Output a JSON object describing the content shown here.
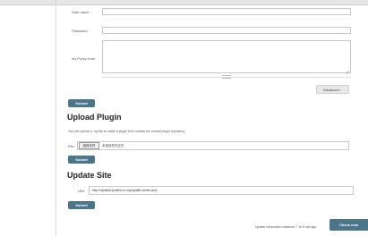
{
  "proxy": {
    "user_name_label": "User name",
    "password_label": "Password",
    "no_proxy_host_label": "No Proxy Host",
    "advanced_label": "Advanced...",
    "submit_label": "Submit"
  },
  "upload": {
    "title": "Upload Plugin",
    "description": "You can upload a .hpi file to install a plugin from outside the central plugin repository.",
    "file_label": "File:",
    "choose_file_label": "选择文件",
    "no_file_label": "未选择任何文件",
    "submit_label": "Submit"
  },
  "update_site": {
    "title": "Update Site",
    "url_label": "URL",
    "url_value": "http://updates.jenkins-ci.org/update-center.json",
    "submit_label": "Submit"
  },
  "footer": {
    "status_text": "Update information obtained: 7 hr 0 min ago",
    "check_now_label": "Check now"
  }
}
